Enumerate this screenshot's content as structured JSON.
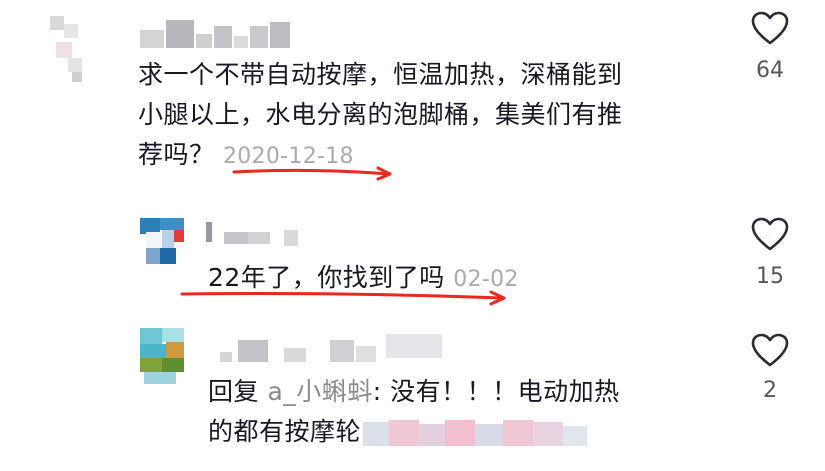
{
  "comments": [
    {
      "line1": "求一个不带自动按摩，恒温加热，深桶能到",
      "line2": "小腿以上，水电分离的泡脚桶，集美们有推",
      "line3": "荐吗？",
      "date": "2020-12-18",
      "likes": "64",
      "icons": {
        "like": "heart-outline-icon"
      }
    },
    {
      "text": "22年了，你找到了吗",
      "date": "02-02",
      "likes": "15"
    },
    {
      "reply_prefix": "回复",
      "reply_user": "a_小蝌蚪",
      "line1_rest": ": 没有！！！电动加热",
      "line2": "的都有按摩轮",
      "likes": "2"
    }
  ],
  "colors": {
    "text": "#161823",
    "muted": "#a9abb1",
    "annotation": "#e8291e"
  }
}
